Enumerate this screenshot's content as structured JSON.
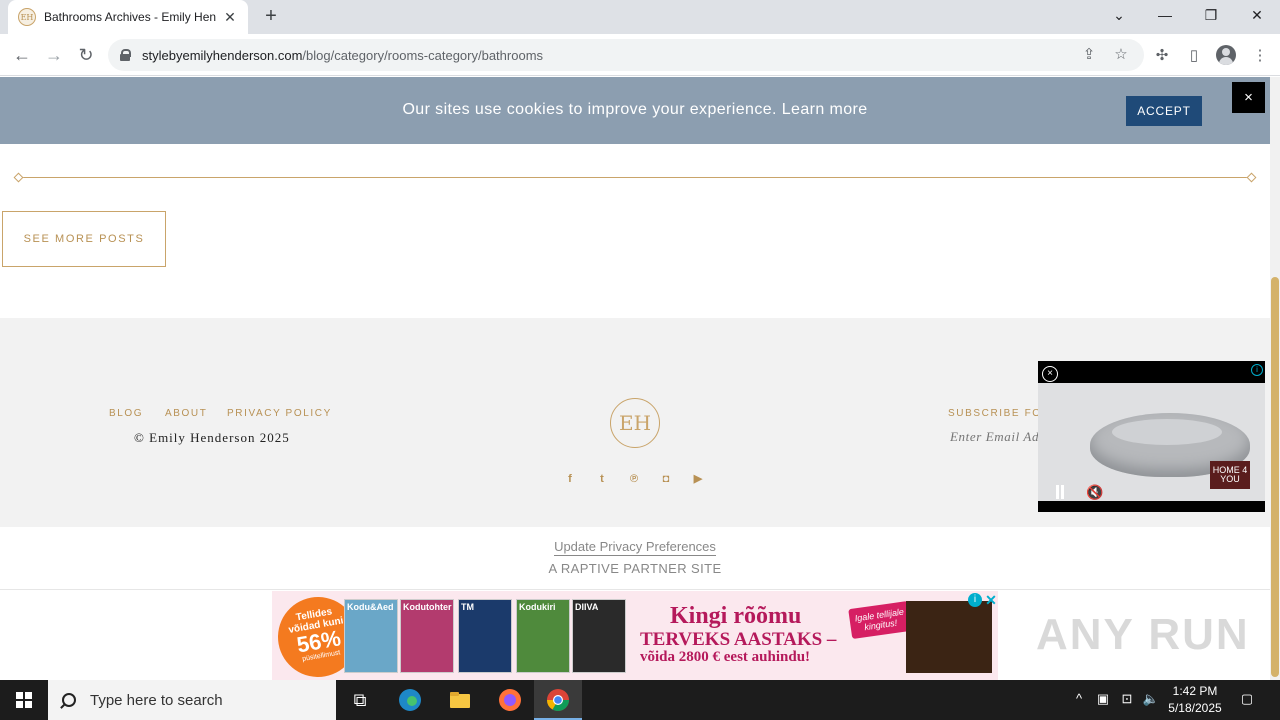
{
  "browser": {
    "tab_title": "Bathrooms Archives - Emily Henderson",
    "tab_favicon_text": "EH",
    "url_host": "stylebyemilyhenderson.com",
    "url_path": "/blog/category/rooms-category/bathrooms"
  },
  "cookie": {
    "message": "Our sites use cookies to improve your experience. Learn more",
    "accept_label": "ACCEPT",
    "close_label": "×"
  },
  "content": {
    "see_more_label": "SEE MORE POSTS"
  },
  "footer": {
    "links": [
      "BLOG",
      "ABOUT",
      "PRIVACY POLICY"
    ],
    "copyright": "© Emily Henderson 2025",
    "logo_text": "EH",
    "social_icons": [
      "facebook-icon",
      "twitter-icon",
      "pinterest-icon",
      "instagram-icon",
      "youtube-icon"
    ],
    "subscribe_label": "SUBSCRIBE FOR",
    "email_placeholder": "Enter Email Address",
    "privacy_prefs": "Update Privacy Preferences",
    "partner": "A RAPTIVE PARTNER SITE"
  },
  "ad": {
    "badge_line1": "Tellides",
    "badge_line2": "võidad kuni",
    "badge_pct": "56%",
    "badge_line3": "püsitellimust",
    "magazines": [
      "Kodu&Aed",
      "Kodutohter",
      "TM",
      "Kodukiri",
      "DIIVA"
    ],
    "headline": "Kingi rõõmu",
    "sub1": "TERVEKS AASTAKS –",
    "sub2": "võida 2800 € eest auhindu!",
    "tag": "Igale tellijale kingitus!",
    "info_label": "i",
    "close_label": "✕"
  },
  "video": {
    "brand": "HOME 4 YOU"
  },
  "watermark": "ANY RUN",
  "taskbar": {
    "search_placeholder": "Type here to search",
    "time": "1:42 PM",
    "date": "5/18/2025"
  },
  "colors": {
    "accent_gold": "#c9a46a",
    "cookie_bg": "#8c9eb0",
    "accept_bg": "#1f4a78",
    "footer_bg": "#f2f2f2"
  }
}
